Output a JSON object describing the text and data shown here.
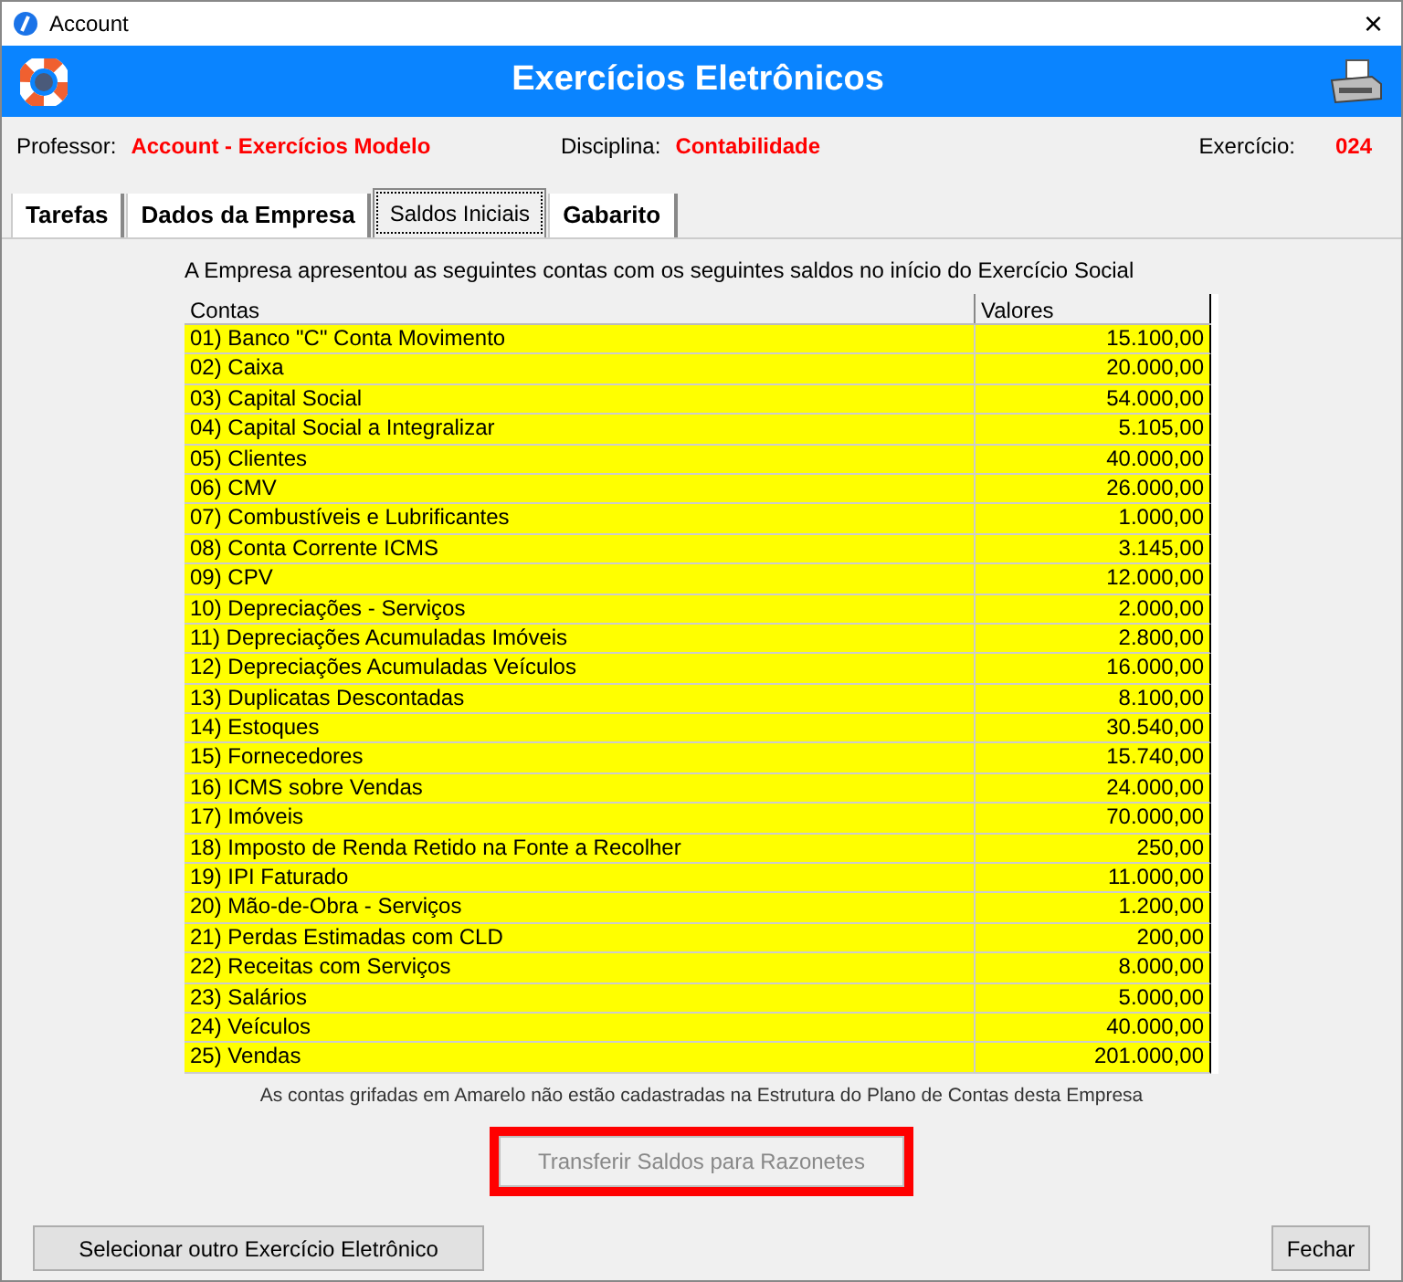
{
  "window": {
    "title": "Account",
    "close": "×"
  },
  "header": {
    "title": "Exercícios Eletrônicos"
  },
  "info": [
    {
      "label": "Professor:",
      "value": "Account - Exercícios Modelo"
    },
    {
      "label": "Disciplina:",
      "value": "Contabilidade"
    },
    {
      "label": "Exercício:",
      "value": "024"
    }
  ],
  "tabs": [
    {
      "label": "Tarefas",
      "selected": false
    },
    {
      "label": "Dados da Empresa",
      "selected": false
    },
    {
      "label": "Saldos Iniciais",
      "selected": true
    },
    {
      "label": "Gabarito",
      "selected": false
    }
  ],
  "intro": "A Empresa apresentou as seguintes contas com os seguintes saldos no início do Exercício Social",
  "table": {
    "columns": [
      "Contas",
      "Valores"
    ],
    "rows": [
      {
        "conta": "01) Banco \"C\" Conta Movimento",
        "valor": "15.100,00",
        "highlighted": true
      },
      {
        "conta": "02) Caixa",
        "valor": "20.000,00",
        "highlighted": true
      },
      {
        "conta": "03) Capital Social",
        "valor": "54.000,00",
        "highlighted": true
      },
      {
        "conta": "04) Capital Social a Integralizar",
        "valor": "5.105,00",
        "highlighted": true
      },
      {
        "conta": "05) Clientes",
        "valor": "40.000,00",
        "highlighted": true
      },
      {
        "conta": "06) CMV",
        "valor": "26.000,00",
        "highlighted": true
      },
      {
        "conta": "07) Combustíveis e Lubrificantes",
        "valor": "1.000,00",
        "highlighted": true
      },
      {
        "conta": "08) Conta Corrente ICMS",
        "valor": "3.145,00",
        "highlighted": true
      },
      {
        "conta": "09) CPV",
        "valor": "12.000,00",
        "highlighted": true
      },
      {
        "conta": "10) Depreciações - Serviços",
        "valor": "2.000,00",
        "highlighted": true
      },
      {
        "conta": "11) Depreciações Acumuladas Imóveis",
        "valor": "2.800,00",
        "highlighted": true
      },
      {
        "conta": "12) Depreciações Acumuladas Veículos",
        "valor": "16.000,00",
        "highlighted": true
      },
      {
        "conta": "13) Duplicatas Descontadas",
        "valor": "8.100,00",
        "highlighted": true
      },
      {
        "conta": "14) Estoques",
        "valor": "30.540,00",
        "highlighted": true
      },
      {
        "conta": "15) Fornecedores",
        "valor": "15.740,00",
        "highlighted": true
      },
      {
        "conta": "16) ICMS sobre Vendas",
        "valor": "24.000,00",
        "highlighted": true
      },
      {
        "conta": "17) Imóveis",
        "valor": "70.000,00",
        "highlighted": true
      },
      {
        "conta": "18) Imposto de Renda Retido na Fonte a Recolher",
        "valor": "250,00",
        "highlighted": true
      },
      {
        "conta": "19) IPI Faturado",
        "valor": "11.000,00",
        "highlighted": true
      },
      {
        "conta": "20) Mão-de-Obra - Serviços",
        "valor": "1.200,00",
        "highlighted": true
      },
      {
        "conta": "21) Perdas Estimadas com CLD",
        "valor": "200,00",
        "highlighted": true
      },
      {
        "conta": "22) Receitas com Serviços",
        "valor": "8.000,00",
        "highlighted": true
      },
      {
        "conta": "23) Salários",
        "valor": "5.000,00",
        "highlighted": true
      },
      {
        "conta": "24) Veículos",
        "valor": "40.000,00",
        "highlighted": true
      },
      {
        "conta": "25) Vendas",
        "valor": "201.000,00",
        "highlighted": true
      }
    ]
  },
  "note": "As contas grifadas em Amarelo não estão cadastradas na Estrutura do Plano de Contas desta Empresa",
  "transfer_button": {
    "label": "Transferir Saldos para Razonetes",
    "disabled": true,
    "marked": true
  },
  "buttons": [
    {
      "label": "Selecionar outro Exercício Eletrônico"
    },
    {
      "label": "Fechar"
    }
  ]
}
